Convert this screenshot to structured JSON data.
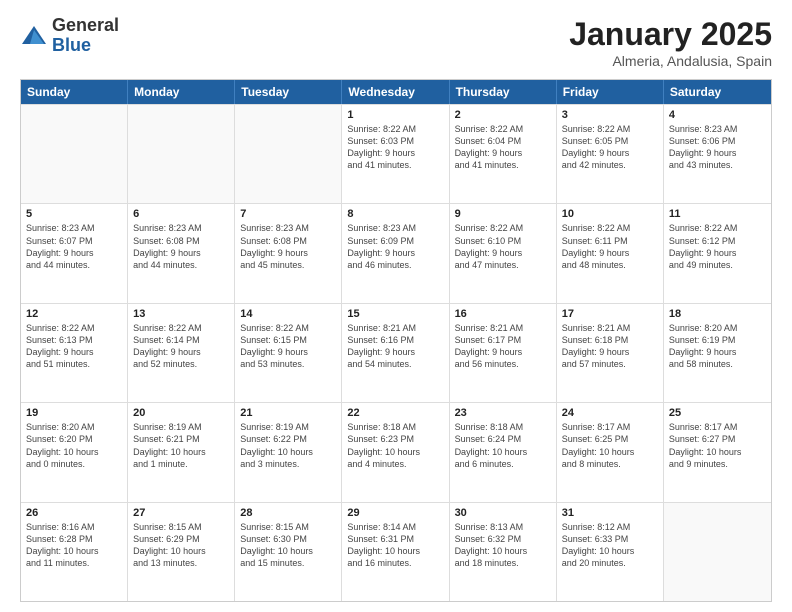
{
  "logo": {
    "general": "General",
    "blue": "Blue"
  },
  "title": {
    "month": "January 2025",
    "location": "Almeria, Andalusia, Spain"
  },
  "weekdays": [
    "Sunday",
    "Monday",
    "Tuesday",
    "Wednesday",
    "Thursday",
    "Friday",
    "Saturday"
  ],
  "weeks": [
    [
      {
        "day": "",
        "info": ""
      },
      {
        "day": "",
        "info": ""
      },
      {
        "day": "",
        "info": ""
      },
      {
        "day": "1",
        "info": "Sunrise: 8:22 AM\nSunset: 6:03 PM\nDaylight: 9 hours\nand 41 minutes."
      },
      {
        "day": "2",
        "info": "Sunrise: 8:22 AM\nSunset: 6:04 PM\nDaylight: 9 hours\nand 41 minutes."
      },
      {
        "day": "3",
        "info": "Sunrise: 8:22 AM\nSunset: 6:05 PM\nDaylight: 9 hours\nand 42 minutes."
      },
      {
        "day": "4",
        "info": "Sunrise: 8:23 AM\nSunset: 6:06 PM\nDaylight: 9 hours\nand 43 minutes."
      }
    ],
    [
      {
        "day": "5",
        "info": "Sunrise: 8:23 AM\nSunset: 6:07 PM\nDaylight: 9 hours\nand 44 minutes."
      },
      {
        "day": "6",
        "info": "Sunrise: 8:23 AM\nSunset: 6:08 PM\nDaylight: 9 hours\nand 44 minutes."
      },
      {
        "day": "7",
        "info": "Sunrise: 8:23 AM\nSunset: 6:08 PM\nDaylight: 9 hours\nand 45 minutes."
      },
      {
        "day": "8",
        "info": "Sunrise: 8:23 AM\nSunset: 6:09 PM\nDaylight: 9 hours\nand 46 minutes."
      },
      {
        "day": "9",
        "info": "Sunrise: 8:22 AM\nSunset: 6:10 PM\nDaylight: 9 hours\nand 47 minutes."
      },
      {
        "day": "10",
        "info": "Sunrise: 8:22 AM\nSunset: 6:11 PM\nDaylight: 9 hours\nand 48 minutes."
      },
      {
        "day": "11",
        "info": "Sunrise: 8:22 AM\nSunset: 6:12 PM\nDaylight: 9 hours\nand 49 minutes."
      }
    ],
    [
      {
        "day": "12",
        "info": "Sunrise: 8:22 AM\nSunset: 6:13 PM\nDaylight: 9 hours\nand 51 minutes."
      },
      {
        "day": "13",
        "info": "Sunrise: 8:22 AM\nSunset: 6:14 PM\nDaylight: 9 hours\nand 52 minutes."
      },
      {
        "day": "14",
        "info": "Sunrise: 8:22 AM\nSunset: 6:15 PM\nDaylight: 9 hours\nand 53 minutes."
      },
      {
        "day": "15",
        "info": "Sunrise: 8:21 AM\nSunset: 6:16 PM\nDaylight: 9 hours\nand 54 minutes."
      },
      {
        "day": "16",
        "info": "Sunrise: 8:21 AM\nSunset: 6:17 PM\nDaylight: 9 hours\nand 56 minutes."
      },
      {
        "day": "17",
        "info": "Sunrise: 8:21 AM\nSunset: 6:18 PM\nDaylight: 9 hours\nand 57 minutes."
      },
      {
        "day": "18",
        "info": "Sunrise: 8:20 AM\nSunset: 6:19 PM\nDaylight: 9 hours\nand 58 minutes."
      }
    ],
    [
      {
        "day": "19",
        "info": "Sunrise: 8:20 AM\nSunset: 6:20 PM\nDaylight: 10 hours\nand 0 minutes."
      },
      {
        "day": "20",
        "info": "Sunrise: 8:19 AM\nSunset: 6:21 PM\nDaylight: 10 hours\nand 1 minute."
      },
      {
        "day": "21",
        "info": "Sunrise: 8:19 AM\nSunset: 6:22 PM\nDaylight: 10 hours\nand 3 minutes."
      },
      {
        "day": "22",
        "info": "Sunrise: 8:18 AM\nSunset: 6:23 PM\nDaylight: 10 hours\nand 4 minutes."
      },
      {
        "day": "23",
        "info": "Sunrise: 8:18 AM\nSunset: 6:24 PM\nDaylight: 10 hours\nand 6 minutes."
      },
      {
        "day": "24",
        "info": "Sunrise: 8:17 AM\nSunset: 6:25 PM\nDaylight: 10 hours\nand 8 minutes."
      },
      {
        "day": "25",
        "info": "Sunrise: 8:17 AM\nSunset: 6:27 PM\nDaylight: 10 hours\nand 9 minutes."
      }
    ],
    [
      {
        "day": "26",
        "info": "Sunrise: 8:16 AM\nSunset: 6:28 PM\nDaylight: 10 hours\nand 11 minutes."
      },
      {
        "day": "27",
        "info": "Sunrise: 8:15 AM\nSunset: 6:29 PM\nDaylight: 10 hours\nand 13 minutes."
      },
      {
        "day": "28",
        "info": "Sunrise: 8:15 AM\nSunset: 6:30 PM\nDaylight: 10 hours\nand 15 minutes."
      },
      {
        "day": "29",
        "info": "Sunrise: 8:14 AM\nSunset: 6:31 PM\nDaylight: 10 hours\nand 16 minutes."
      },
      {
        "day": "30",
        "info": "Sunrise: 8:13 AM\nSunset: 6:32 PM\nDaylight: 10 hours\nand 18 minutes."
      },
      {
        "day": "31",
        "info": "Sunrise: 8:12 AM\nSunset: 6:33 PM\nDaylight: 10 hours\nand 20 minutes."
      },
      {
        "day": "",
        "info": ""
      }
    ]
  ]
}
